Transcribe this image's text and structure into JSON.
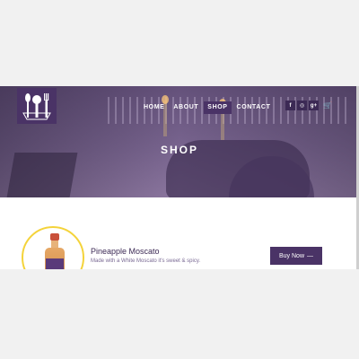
{
  "header": {
    "logo_alt": "logo-mark",
    "nav": [
      {
        "label": "HOME",
        "active": false
      },
      {
        "label": "ABOUT",
        "active": false
      },
      {
        "label": "SHOP",
        "active": true
      },
      {
        "label": "CONTACT",
        "active": false
      }
    ],
    "social": [
      {
        "icon": "facebook-icon",
        "glyph": "f"
      },
      {
        "icon": "instagram-icon",
        "glyph": "◎"
      },
      {
        "icon": "google-plus-icon",
        "glyph": "g+"
      }
    ],
    "cart_icon": "cart-icon"
  },
  "hero": {
    "title": "SHOP"
  },
  "product": {
    "name": "Pineapple Moscato",
    "description": "Made with a White Moscato it's sweet & spicy.",
    "buy_label": "Buy Now",
    "buy_arrow": "—"
  },
  "colors": {
    "brand_purple": "#4a3366",
    "accent_yellow": "#f4d33a",
    "text_purple": "#3c2a55"
  }
}
